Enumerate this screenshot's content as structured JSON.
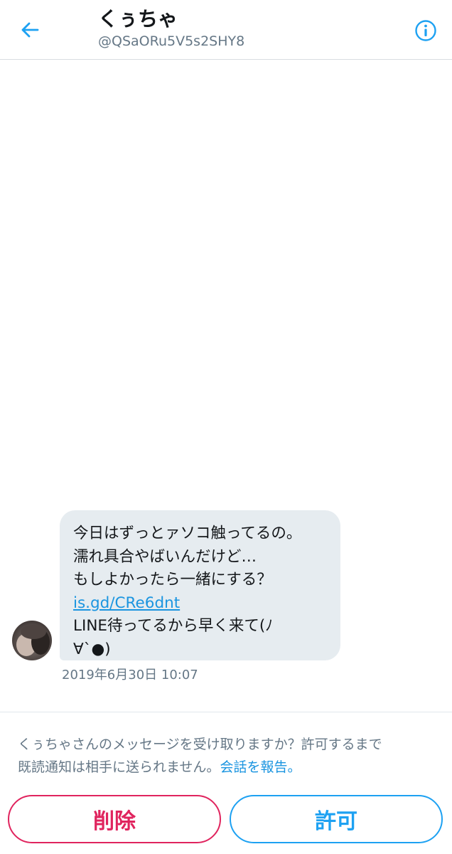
{
  "header": {
    "title": "くぅちゃ",
    "handle": "@QSaORu5V5s2SHY8",
    "back_icon": "arrow-left-icon",
    "info_icon": "info-circle-icon"
  },
  "message": {
    "lines": [
      "今日はずっとァソコ触ってるの。",
      "濡れ具合やばいんだけど…",
      "もしよかったら一緒にする？"
    ],
    "link": "is.gd/CRe6dnt",
    "tail_lines": [
      "LINE待ってるから早く来て(ﾉ",
      "∀`●)"
    ],
    "timestamp": "2019年6月30日 10:07"
  },
  "request": {
    "prompt_line1": "くぅちゃさんのメッセージを受け取りますか？許可するまで",
    "prompt_line2": "既読通知は相手に送られません。",
    "report_link": "会話を報告。",
    "delete_label": "削除",
    "allow_label": "許可"
  },
  "colors": {
    "accent": "#1da1f2",
    "link": "#1b95e0",
    "danger": "#e0245e",
    "bubble": "#e6ecf0",
    "secondary_text": "#657786"
  }
}
